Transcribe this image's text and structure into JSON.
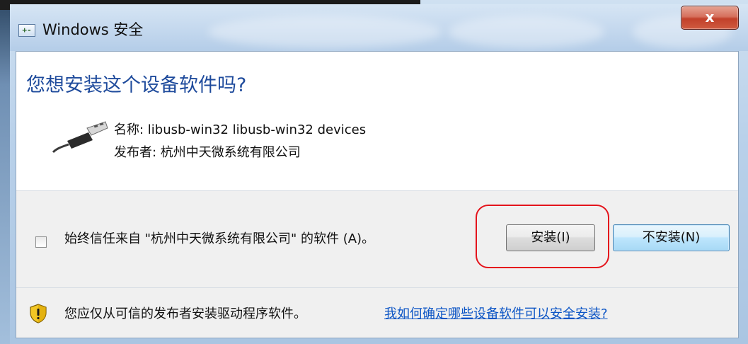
{
  "window": {
    "title": "Windows 安全",
    "close_glyph": "x",
    "app_icon_glyph": "+-"
  },
  "dialog": {
    "question": "您想安装这个设备软件吗?",
    "name_line": "名称: libusb-win32 libusb-win32 devices",
    "publisher_line": "发布者: 杭州中天微系统有限公司",
    "device_icon": "usb-connector-icon"
  },
  "trust": {
    "checkbox_checked": false,
    "label": "始终信任来自 \"杭州中天微系统有限公司\" 的软件 (A)。"
  },
  "buttons": {
    "install": "安装(I)",
    "do_not_install": "不安装(N)"
  },
  "footer": {
    "warning_icon": "shield-warning-icon",
    "text": "您应仅从可信的发布者安装驱动程序软件。",
    "link": "我如何确定哪些设备软件可以安全安装?"
  },
  "colors": {
    "question_blue": "#1f4b9c",
    "link_blue": "#0c55c5",
    "highlight_red": "#e4141c",
    "close_red": "#c2402a"
  }
}
